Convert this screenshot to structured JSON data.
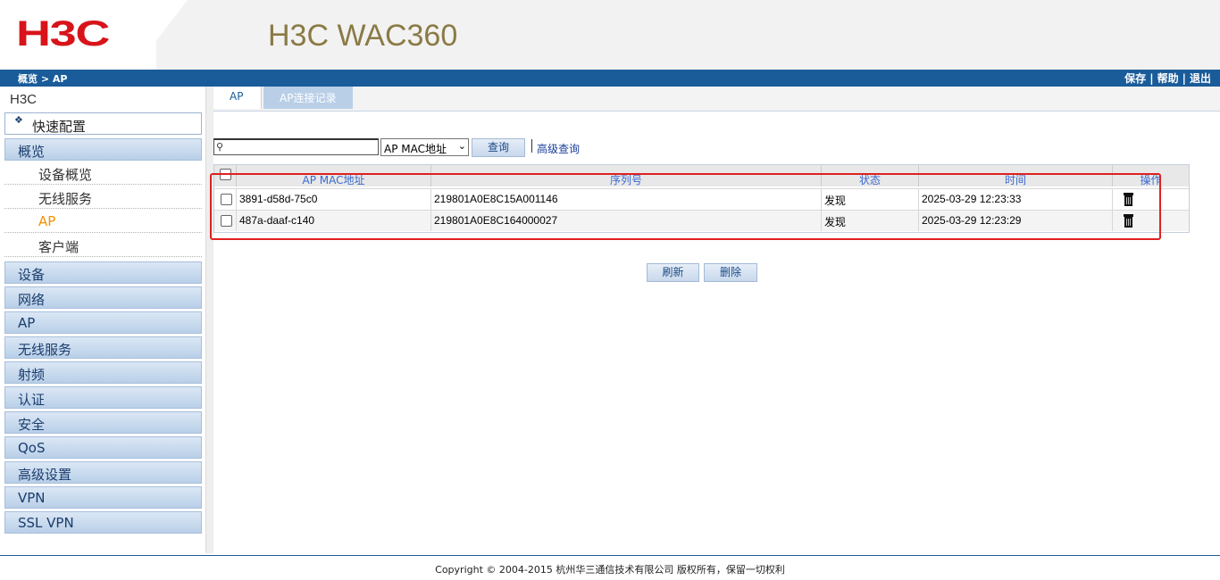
{
  "header": {
    "logo_text": "H3C",
    "product_title": "H3C WAC360"
  },
  "colors": {
    "brand_red": "#d7141a",
    "nav_blue": "#1a5c9a",
    "active_orange": "#f29100",
    "highlight_red": "#e02020"
  },
  "topbar": {
    "breadcrumb": "概览 > AP",
    "links": [
      "保存",
      "帮助",
      "退出"
    ],
    "separator": "|"
  },
  "sidebar": {
    "root": "H3C",
    "quick_config": "快速配置",
    "overview": "概览",
    "overview_items": [
      "设备概览",
      "无线服务",
      "AP",
      "客户端"
    ],
    "active_item": "AP",
    "sections": [
      "设备",
      "网络",
      "AP",
      "无线服务",
      "射频",
      "认证",
      "安全",
      "QoS",
      "高级设置",
      "VPN",
      "SSL VPN"
    ]
  },
  "tabs": {
    "ap": "AP",
    "log": "AP连接记录"
  },
  "search": {
    "value": "",
    "placeholder": "",
    "field_select": "AP MAC地址",
    "query_button": "查询",
    "advanced_link": "高级查询"
  },
  "table": {
    "columns": [
      "AP MAC地址",
      "序列号",
      "状态",
      "时间",
      "操作"
    ],
    "rows": [
      {
        "mac": "3891-d58d-75c0",
        "serial": "219801A0E8C15A001146",
        "status": "发现",
        "time": "2025-03-29 12:23:33",
        "action_icon": "trash-icon"
      },
      {
        "mac": "487a-daaf-c140",
        "serial": "219801A0E8C164000027",
        "status": "发现",
        "time": "2025-03-29 12:23:29",
        "action_icon": "trash-icon"
      }
    ]
  },
  "actions": {
    "refresh": "刷新",
    "delete": "删除"
  },
  "footer": {
    "copyright": "Copyright © 2004-2015 杭州华三通信技术有限公司 版权所有，保留一切权利"
  }
}
